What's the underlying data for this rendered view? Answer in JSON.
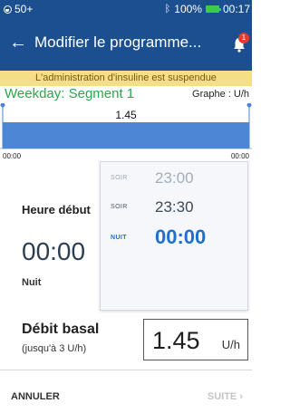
{
  "status_bar": {
    "pod_label": "50+",
    "bluetooth_icon": "bluetooth-icon",
    "battery_percent": "100%",
    "clock": "00:17",
    "battery_level": 1.0
  },
  "header": {
    "title": "Modifier le programme...",
    "notification_count": "1"
  },
  "banner": {
    "text": "L'administration d'insuline est suspendue"
  },
  "segment": {
    "title": "Weekday: Segment 1",
    "graph_label": "Graphe : U/h"
  },
  "chart_data": {
    "type": "area",
    "series": [
      {
        "x": [
          "00:00",
          "00:00"
        ],
        "values": [
          1.45,
          1.45
        ]
      }
    ],
    "data_label": "1.45",
    "x_tick_labels": [
      "00:00",
      "00:00"
    ],
    "colors": {
      "fill": "#4d86d4",
      "marker": "#4d86d4"
    }
  },
  "start_time": {
    "label": "Heure début",
    "value": "00:00",
    "period": "Nuit"
  },
  "time_picker": {
    "options": [
      {
        "period": "SOIR",
        "time": "23:00",
        "state": "faded"
      },
      {
        "period": "SOIR",
        "time": "23:30",
        "state": "normal"
      },
      {
        "period": "NUIT",
        "time": "00:00",
        "state": "selected"
      }
    ]
  },
  "basal_rate": {
    "label": "Débit basal",
    "max_note": "(jusqu'à 3 U/h)",
    "value": "1.45",
    "unit": "U/h"
  },
  "footer": {
    "cancel_label": "ANNULER",
    "next_label": "SUITE",
    "next_icon": "chevron-right-icon"
  },
  "colors": {
    "header_bg": "#1b4f8f",
    "banner_bg": "#f5de88",
    "segment_title": "#2aa84a",
    "selected_time": "#1e6fd0",
    "badge": "#e53b2c"
  }
}
